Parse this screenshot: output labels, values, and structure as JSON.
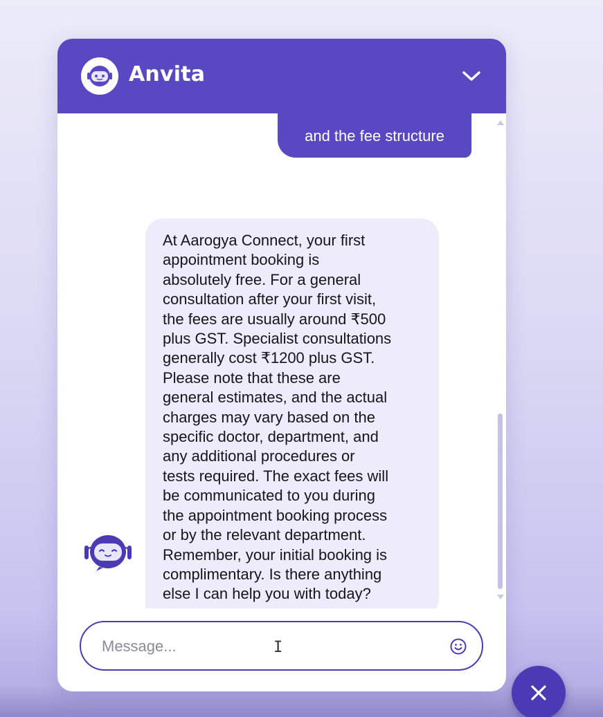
{
  "colors": {
    "brand": "#5848c2",
    "brand_dark": "#4a3ab4",
    "bot_bubble_bg": "#eeecfb",
    "user_bubble_text": "#ffffff"
  },
  "header": {
    "title": "Anvita",
    "avatar_icon": "robot-icon",
    "toggle_icon": "chevron-down-icon"
  },
  "messages": [
    {
      "sender": "user",
      "text": "and the fee structure"
    },
    {
      "sender": "bot",
      "avatar_icon": "robot-icon",
      "text": "At Aarogya Connect, your first appointment booking is absolutely free. For a general consultation after your first visit, the fees are usually around ₹500 plus GST. Specialist consultations generally cost ₹1200 plus GST. Please note that these are general estimates, and the actual charges may vary based on the specific doctor, department, and any additional procedures or tests required. The exact fees will be communicated to you during the appointment booking process or by the relevant department. Remember, your initial booking is complimentary. Is there anything else I can help you with today?",
      "lines": [
        "At Aarogya Connect, your first",
        "appointment booking is",
        "absolutely free. For a general",
        "consultation after your first visit,",
        "the fees are usually around ₹500",
        "plus GST. Specialist consultations",
        "generally cost ₹1200 plus GST.",
        "Please note that these are",
        "general estimates, and the actual",
        "charges may vary based on the",
        "specific doctor, department, and",
        "any additional procedures or",
        "tests required. The exact fees will",
        "be communicated to you during",
        "the appointment booking process",
        "or by the relevant department.",
        "Remember, your initial booking is",
        "complimentary. Is there anything",
        "else I can help you with today?"
      ]
    }
  ],
  "composer": {
    "placeholder": "Message...",
    "value": "",
    "emoji_icon": "smiley-icon"
  },
  "close_button_icon": "close-icon"
}
